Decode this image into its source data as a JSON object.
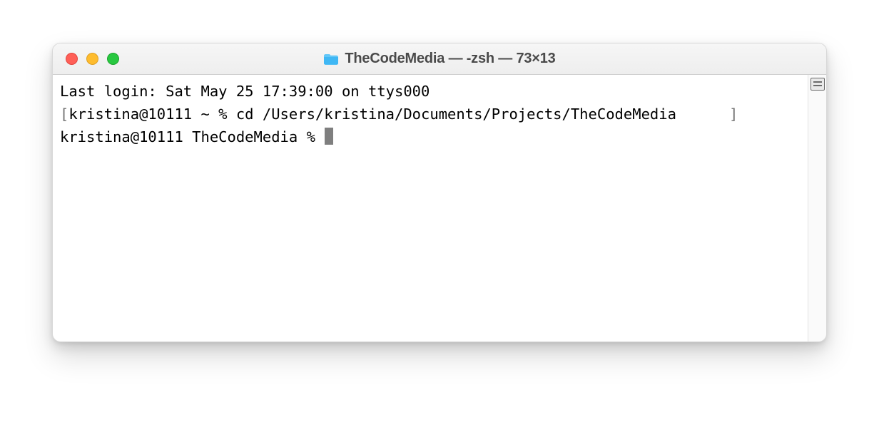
{
  "window": {
    "title": "TheCodeMedia — -zsh — 73×13"
  },
  "terminal": {
    "last_login": "Last login: Sat May 25 17:39:00 on ttys000",
    "line1_lb": "[",
    "line1_prompt": "kristina@10111 ~ % ",
    "line1_cmd": "cd /Users/kristina/Documents/Projects/TheCodeMedia",
    "line1_rb": "      ]",
    "line2_prompt": "kristina@10111 TheCodeMedia % "
  }
}
